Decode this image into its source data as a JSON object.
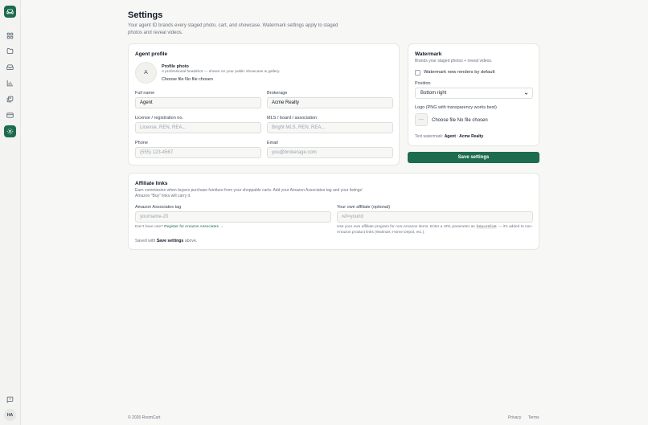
{
  "page": {
    "title": "Settings",
    "subtitle": "Your agent ID brands every staged photo, cart, and showcase. Watermark settings apply to staged photos and reveal videos."
  },
  "sidebar": {
    "items": [
      {
        "icon": "dashboard-icon"
      },
      {
        "icon": "folder-icon"
      },
      {
        "icon": "inbox-icon"
      },
      {
        "icon": "chart-icon"
      },
      {
        "icon": "gallery-icon"
      },
      {
        "icon": "card-icon"
      },
      {
        "icon": "settings-icon",
        "active": true
      }
    ],
    "feedback_icon": "message-icon",
    "user_initials": "HA"
  },
  "agent_profile": {
    "title": "Agent profile",
    "avatar_initial": "A",
    "photo_label": "Profile photo",
    "photo_help": "A professional headshot — shown on your public showcase & gallery.",
    "photo_file": "Choose file No file chosen",
    "full_name_label": "Full name",
    "full_name_value": "Agent",
    "brokerage_label": "Brokerage",
    "brokerage_value": "Acme Realty",
    "license_label": "License / registration no.",
    "license_placeholder": "License, REN, REA...",
    "mls_label": "MLS / board / association",
    "mls_placeholder": "Bright MLS, REN, REA...",
    "phone_label": "Phone",
    "phone_placeholder": "(555) 123-4567",
    "email_label": "Email",
    "email_placeholder": "you@brokerage.com"
  },
  "watermark": {
    "title": "Watermark",
    "subtitle": "Brands your staged photos + reveal videos.",
    "default_checkbox_label": "Watermark new renders by default",
    "position_label": "Position",
    "position_value": "Bottom right",
    "logo_label": "Logo (PNG with transparency works best)",
    "logo_placeholder": "—",
    "logo_file": "Choose file No file chosen",
    "text_watermark_label": "Text watermark:",
    "text_watermark_value": "Agent · Acme Realty"
  },
  "save_button": "Save settings",
  "affiliate": {
    "title": "Affiliate links",
    "description": "Earn commission when buyers purchase furniture from your shoppable carts. Add your Amazon Associates tag and your listings' Amazon \"Buy\" links will carry it.",
    "amazon_label": "Amazon Associates tag",
    "amazon_placeholder": "yourname-20",
    "amazon_help_prefix": "Don't have one?",
    "amazon_help_link": "Register for Amazon Associates →",
    "own_label": "Your own affiliate (optional)",
    "own_placeholder": "ref=yourid",
    "own_help_1": "Use your own affiliate program for non-Amazon items. Enter a URL parameter as",
    "own_help_code": "key=value",
    "own_help_2": "— it's added to non-Amazon product links (Walmart, Home Depot, etc.).",
    "saved_prefix": "Saved with",
    "saved_bold": "Save settings",
    "saved_suffix": "above."
  },
  "footer": {
    "copyright": "© 2026 RoomCart",
    "privacy": "Privacy",
    "terms": "Terms"
  },
  "colors": {
    "accent": "#1d6b50",
    "background": "#f7f7f5"
  }
}
